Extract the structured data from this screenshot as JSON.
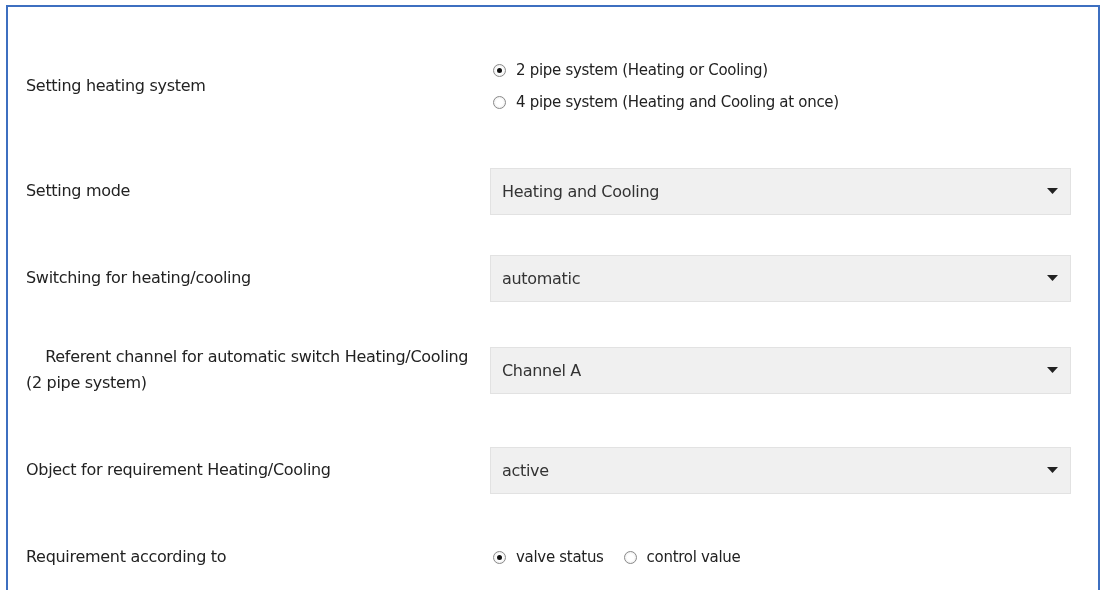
{
  "parameters": [
    {
      "label": "Setting heating system",
      "kind": "radiolist",
      "options": [
        {
          "label": "2 pipe system (Heating or Cooling)",
          "selected": true
        },
        {
          "label": "4 pipe system (Heating and Cooling at once)",
          "selected": false
        }
      ]
    },
    {
      "label": "Setting mode",
      "kind": "dropdown",
      "value": "Heating and Cooling"
    },
    {
      "label": "Switching for heating/cooling",
      "kind": "dropdown",
      "value": "automatic"
    },
    {
      "label": "    Referent channel for automatic switch Heating/Cooling (2 pipe system)",
      "kind": "dropdown",
      "value": "Channel A"
    },
    {
      "label": "Object for requirement Heating/Cooling",
      "kind": "dropdown",
      "value": "active"
    },
    {
      "label": "Requirement according to",
      "kind": "radiorow",
      "options": [
        {
          "label": "valve status",
          "selected": true
        },
        {
          "label": "control value",
          "selected": false
        }
      ]
    }
  ]
}
